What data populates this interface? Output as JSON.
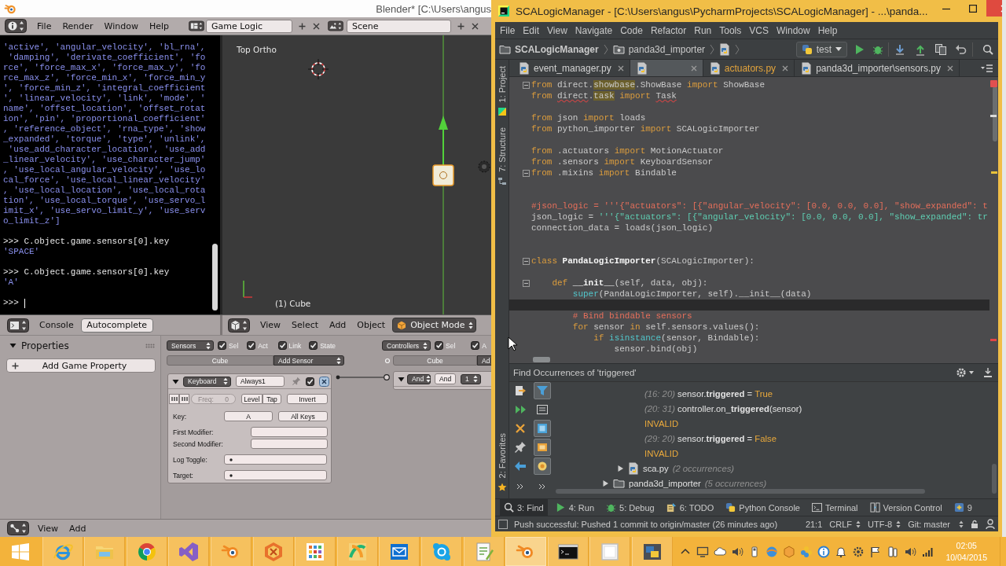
{
  "blender": {
    "title": "Blender* [C:\\Users\\angus",
    "menu": [
      "File",
      "Render",
      "Window",
      "Help"
    ],
    "layout": "Game Logic",
    "scene": "Scene",
    "console": {
      "menu": "Console",
      "autocomplete": "Autocomplete",
      "lines": [
        {
          "kind": "output",
          "text": "'active', 'angular_velocity', 'bl_rna',"
        },
        {
          "kind": "output",
          "text": " 'damping', 'derivate_coefficient', 'fo"
        },
        {
          "kind": "output",
          "text": "rce', 'force_max_x', 'force_max_y', 'fo"
        },
        {
          "kind": "output",
          "text": "rce_max_z', 'force_min_x', 'force_min_y"
        },
        {
          "kind": "output",
          "text": "', 'force_min_z', 'integral_coefficient"
        },
        {
          "kind": "output",
          "text": "', 'linear_velocity', 'link', 'mode', '"
        },
        {
          "kind": "output",
          "text": "name', 'offset_location', 'offset_rotat"
        },
        {
          "kind": "output",
          "text": "ion', 'pin', 'proportional_coefficient'"
        },
        {
          "kind": "output",
          "text": ", 'reference_object', 'rna_type', 'show"
        },
        {
          "kind": "output",
          "text": "_expanded', 'torque', 'type', 'unlink',"
        },
        {
          "kind": "output",
          "text": " 'use_add_character_location', 'use_add"
        },
        {
          "kind": "output",
          "text": "_linear_velocity', 'use_character_jump'"
        },
        {
          "kind": "output",
          "text": ", 'use_local_angular_velocity', 'use_lo"
        },
        {
          "kind": "output",
          "text": "cal_force', 'use_local_linear_velocity'"
        },
        {
          "kind": "output",
          "text": ", 'use_local_location', 'use_local_rota"
        },
        {
          "kind": "output",
          "text": "tion', 'use_local_torque', 'use_servo_l"
        },
        {
          "kind": "output",
          "text": "imit_x', 'use_servo_limit_y', 'use_serv"
        },
        {
          "kind": "output",
          "text": "o_limit_z']"
        },
        {
          "kind": "input",
          "text": ">>> C.object.game.sensors[0].key"
        },
        {
          "kind": "output",
          "text": "'SPACE'"
        },
        {
          "kind": "input",
          "text": ">>> C.object.game.sensors[0].key"
        },
        {
          "kind": "output",
          "text": "'A'"
        },
        {
          "kind": "prompt",
          "text": ">>>"
        }
      ]
    },
    "viewport": {
      "view_name": "Top Ortho",
      "object_name": "(1) Cube",
      "menu": [
        "View",
        "Select",
        "Add",
        "Object"
      ],
      "mode": "Object Mode"
    },
    "logic": {
      "properties": {
        "title": "Properties",
        "expanded": true,
        "add_button": "Add Game Property"
      },
      "sensors": {
        "menu": "Sensors",
        "filters": [
          {
            "label": "Sel",
            "checked": true
          },
          {
            "label": "Act",
            "checked": true
          },
          {
            "label": "Link",
            "checked": true
          },
          {
            "label": "State",
            "checked": true
          }
        ],
        "object": "Cube",
        "add_menu": "Add Sensor",
        "brick": {
          "expanded": true,
          "type": "Keyboard",
          "name": "Always1",
          "active": true,
          "freq_label": "Freq:",
          "freq": "0",
          "modes": [
            "Level",
            "Tap"
          ],
          "invert": "Invert",
          "fields": [
            {
              "kind": "keys",
              "label": "Key:",
              "values": [
                "A",
                "All Keys"
              ]
            },
            {
              "kind": "text",
              "label": "First Modifier:"
            },
            {
              "kind": "text",
              "label": "Second Modifier:"
            },
            {
              "kind": "property",
              "label": "Log Toggle:"
            },
            {
              "kind": "property",
              "label": "Target:"
            }
          ]
        }
      },
      "controllers": {
        "menu": "Controllers",
        "filters": [
          {
            "label": "Sel",
            "checked": true
          },
          {
            "label": "A",
            "checked": true
          }
        ],
        "object": "Cube",
        "add_menu": "Ad",
        "brick": {
          "expanded": true,
          "type": "And",
          "name": "And",
          "state": "1"
        }
      },
      "header_menu": [
        "View",
        "Add"
      ]
    }
  },
  "pycharm": {
    "title": "SCALogicManager - [C:\\Users\\angus\\PycharmProjects\\SCALogicManager] - ...\\panda...",
    "menu": [
      "File",
      "Edit",
      "View",
      "Navigate",
      "Code",
      "Refactor",
      "Run",
      "Tools",
      "VCS",
      "Window",
      "Help"
    ],
    "breadcrumbs": [
      {
        "kind": "project",
        "label": "SCALogicManager"
      },
      {
        "kind": "package",
        "label": "panda3d_importer"
      },
      {
        "kind": "file"
      }
    ],
    "run_config": "test",
    "side_tools": [
      {
        "kind": "project",
        "label": "1: Project"
      },
      {
        "kind": "structure",
        "label": "7: Structure"
      },
      {
        "kind": "favorites",
        "label": "2: Favorites"
      }
    ],
    "tabs": [
      {
        "label": "event_manager.py",
        "selected": false,
        "color": "#d2d2d2"
      },
      {
        "selected": true
      },
      {
        "label": "actuators.py",
        "selected": false,
        "color": "#e3a43c"
      },
      {
        "label": "panda3d_importer\\sensors.py",
        "selected": false,
        "color": "#d2d2d2"
      }
    ],
    "code": [
      {
        "tokens": [
          {
            "kind": "kw",
            "text": "from"
          },
          {
            "kind": "plain",
            "text": " direct."
          },
          {
            "kind": "marked",
            "text": "showbase"
          },
          {
            "kind": "plain",
            "text": ".ShowBase "
          },
          {
            "kind": "kw",
            "text": "import"
          },
          {
            "kind": "plain",
            "text": " ShowBase"
          }
        ],
        "current": false,
        "fold": true
      },
      {
        "tokens": [
          {
            "kind": "kw",
            "text": "from "
          },
          {
            "kind": "unresolved",
            "text": "direct"
          },
          {
            "kind": "plain",
            "text": "."
          },
          {
            "kind": "marked",
            "text": "task"
          },
          {
            "kind": "kw",
            "text": " import "
          },
          {
            "kind": "unresolved",
            "text": "Task"
          }
        ],
        "current": false,
        "fold": false
      },
      {
        "current": false,
        "fold": false
      },
      {
        "tokens": [
          {
            "kind": "kw",
            "text": "from"
          },
          {
            "kind": "plain",
            "text": " json "
          },
          {
            "kind": "kw",
            "text": "import"
          },
          {
            "kind": "plain",
            "text": " loads"
          }
        ],
        "current": false,
        "fold": false
      },
      {
        "tokens": [
          {
            "kind": "kw",
            "text": "from"
          },
          {
            "kind": "plain",
            "text": " python_importer "
          },
          {
            "kind": "kw",
            "text": "import"
          },
          {
            "kind": "plain",
            "text": " SCALogicImporter"
          }
        ],
        "current": false,
        "fold": false
      },
      {
        "current": false,
        "fold": false
      },
      {
        "tokens": [
          {
            "kind": "kw",
            "text": "from"
          },
          {
            "kind": "plain",
            "text": " .actuators "
          },
          {
            "kind": "kw",
            "text": "import"
          },
          {
            "kind": "plain",
            "text": " MotionActuator"
          }
        ],
        "current": false,
        "fold": false
      },
      {
        "tokens": [
          {
            "kind": "kw",
            "text": "from"
          },
          {
            "kind": "plain",
            "text": " .sensors "
          },
          {
            "kind": "kw",
            "text": "import"
          },
          {
            "kind": "plain",
            "text": " KeyboardSensor"
          }
        ],
        "current": false,
        "fold": false
      },
      {
        "tokens": [
          {
            "kind": "kw",
            "text": "from"
          },
          {
            "kind": "plain",
            "text": " .mixins "
          },
          {
            "kind": "kw",
            "text": "import"
          },
          {
            "kind": "plain",
            "text": " Bindable"
          }
        ],
        "current": false,
        "fold": true
      },
      {
        "current": false,
        "fold": false
      },
      {
        "current": false,
        "fold": false
      },
      {
        "tokens": [
          {
            "kind": "comment",
            "text": "#json_logic = '''{\"actuators\": [{\"angular_velocity\": [0.0, 0.0, 0.0], \"show_expanded\": t"
          }
        ],
        "current": false,
        "fold": false
      },
      {
        "tokens": [
          {
            "kind": "plain",
            "text": "json_logic = "
          },
          {
            "kind": "string",
            "text": "'''{\"actuators\": [{\"angular_velocity\": [0.0, 0.0, 0.0], \"show_expanded\": tr"
          }
        ],
        "current": false,
        "fold": false
      },
      {
        "tokens": [
          {
            "kind": "plain",
            "text": "connection_data = loads(json_logic)"
          }
        ],
        "current": false,
        "fold": false
      },
      {
        "current": false,
        "fold": false
      },
      {
        "current": false,
        "fold": false
      },
      {
        "tokens": [
          {
            "kind": "kw",
            "text": "class "
          },
          {
            "kind": "defname",
            "text": "PandaLogicImporter"
          },
          {
            "kind": "plain",
            "text": "(SCALogicImporter):"
          }
        ],
        "current": false,
        "fold": true
      },
      {
        "current": false,
        "fold": false
      },
      {
        "tokens": [
          {
            "kind": "kw",
            "text": "    def "
          },
          {
            "kind": "defname",
            "text": "__init__"
          },
          {
            "kind": "plain",
            "text": "(self, data, obj):"
          }
        ],
        "current": false,
        "fold": true
      },
      {
        "tokens": [
          {
            "kind": "builtin",
            "text": "        super"
          },
          {
            "kind": "plain",
            "text": "(PandaLogicImporter, self).__init__(data)"
          }
        ],
        "current": false,
        "fold": false
      },
      {
        "current": true,
        "fold": false
      },
      {
        "tokens": [
          {
            "kind": "comment",
            "text": "        # Bind bindable sensors"
          }
        ],
        "current": false,
        "fold": false
      },
      {
        "tokens": [
          {
            "kind": "kw",
            "text": "        for"
          },
          {
            "kind": "plain",
            "text": " sensor "
          },
          {
            "kind": "kw",
            "text": "in"
          },
          {
            "kind": "plain",
            "text": " self.sensors.values():"
          }
        ],
        "current": false,
        "fold": false
      },
      {
        "tokens": [
          {
            "kind": "kw",
            "text": "            if "
          },
          {
            "kind": "builtin",
            "text": "isinstance"
          },
          {
            "kind": "plain",
            "text": "(sensor, Bindable):"
          }
        ],
        "current": false,
        "fold": false
      },
      {
        "tokens": [
          {
            "kind": "plain",
            "text": "                sensor.bind(obj)"
          }
        ],
        "current": false,
        "fold": false
      }
    ],
    "find": {
      "title": "Find Occurrences of 'triggered'",
      "toggles": [
        {
          "kind": "filter",
          "on": true
        },
        {
          "kind": "group",
          "on": false
        },
        {
          "kind": "module",
          "on": true
        },
        {
          "kind": "folder",
          "on": true
        },
        {
          "kind": "file",
          "on": true
        }
      ],
      "tree": [
        {
          "children": [
            {
              "children": [
                {
                  "kind": "usage",
                  "location": "(16: 20)",
                  "code": "sensor.**triggered** = ",
                  "value": "True"
                },
                {
                  "kind": "usage",
                  "location": "(20: 31)",
                  "code": "controller.on_**triggered**(sensor)"
                },
                {
                  "kind": "invalid",
                  "label": "INVALID"
                },
                {
                  "kind": "usage",
                  "location": "(29: 20)",
                  "code": "sensor.**triggered** = ",
                  "value": "False"
                },
                {
                  "kind": "invalid",
                  "label": "INVALID"
                }
              ]
            },
            {
              "kind": "file",
              "label": "sca.py",
              "count": "(2 occurrences)",
              "expanded": false
            }
          ]
        },
        {
          "kind": "folder",
          "label": "panda3d_importer",
          "count": "(5 occurrences)",
          "expanded": false
        }
      ]
    },
    "tool_tabs": [
      {
        "kind": "find",
        "label": "3: Find",
        "selected": true
      },
      {
        "kind": "run",
        "label": "4: Run",
        "selected": false
      },
      {
        "kind": "debug",
        "label": "5: Debug",
        "selected": false
      },
      {
        "kind": "todo",
        "label": "6: TODO",
        "selected": false
      },
      {
        "kind": "console",
        "label": "Python Console",
        "selected": false
      },
      {
        "kind": "terminal",
        "label": "Terminal",
        "selected": false
      },
      {
        "kind": "vcs",
        "label": "Version Control",
        "selected": false
      },
      {
        "kind": "changes",
        "label": "9",
        "selected": false
      }
    ],
    "status": {
      "message": "Push successful: Pushed 1 commit to origin/master (26 minutes ago)",
      "position": "21:1",
      "line_separator": "CRLF",
      "encoding": "UTF-8",
      "branch": "Git: master"
    }
  },
  "taskbar": {
    "time": "02:05",
    "date": "10/04/2015"
  }
}
